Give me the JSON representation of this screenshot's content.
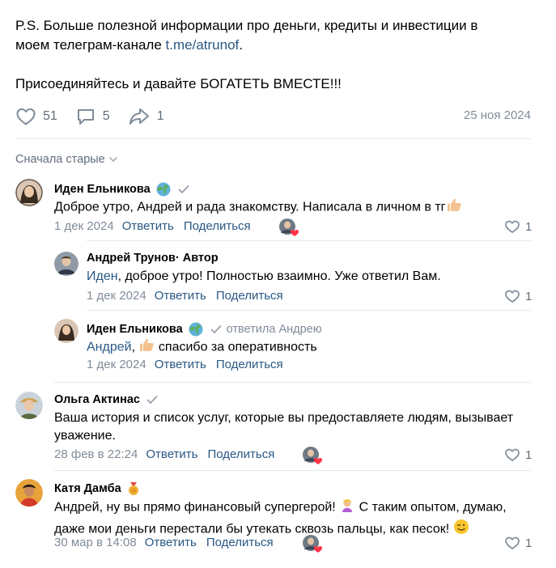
{
  "post": {
    "line1": "P.S. Больше полезной информации про деньги, кредиты и инвестиции в",
    "line2_prefix": "моем телеграм-канале ",
    "line2_link": "t.me/atrunof",
    "line2_suffix": ".",
    "line3": "Присоединяйтесь и давайте БОГАТЕТЬ ВМЕСТЕ!!!",
    "likes": "51",
    "comments": "5",
    "shares": "1",
    "date": "25 ноя 2024"
  },
  "sort_label": "Сначала старые",
  "labels": {
    "reply": "Ответить",
    "share": "Поделиться"
  },
  "comments": [
    {
      "name": "Иден Ельникова",
      "text": "Доброе утро, Андрей и рада знакомству. Написала в личном в тг",
      "date": "1 дек 2024",
      "likes": "1"
    },
    {
      "name": "Андрей Трунов",
      "suffix": " · Автор",
      "mention": "Иден",
      "text": ", доброе утро! Полностью взаимно. Уже ответил Вам.",
      "date": "1 дек 2024",
      "likes": "1"
    },
    {
      "name": "Иден Ельникова",
      "reply_to": "ответила Андрею",
      "mention": "Андрей",
      "text": " спасибо за оперативность",
      "date": "1 дек 2024"
    },
    {
      "name": "Ольга Актинас",
      "text_line1": "Ваша история и список услуг, которые вы предоставляете людям, вызывает",
      "text_line2": "уважение.",
      "date": "28 фев в 22:24",
      "likes": "1"
    },
    {
      "name": "Катя Дамба",
      "text_line1": "Андрей, ну вы прямо финансовый супергерой!",
      "text_line1b": " С таким опытом, думаю,",
      "text_line2": "даже мои деньги перестали бы утекать сквозь пальцы, как песок!",
      "date": "30 мар в 14:08",
      "likes": "1"
    }
  ],
  "colors": {
    "link": "#2a5885",
    "meta": "#818c99",
    "divider": "#e7e8ec",
    "heart": "#ff3347"
  }
}
